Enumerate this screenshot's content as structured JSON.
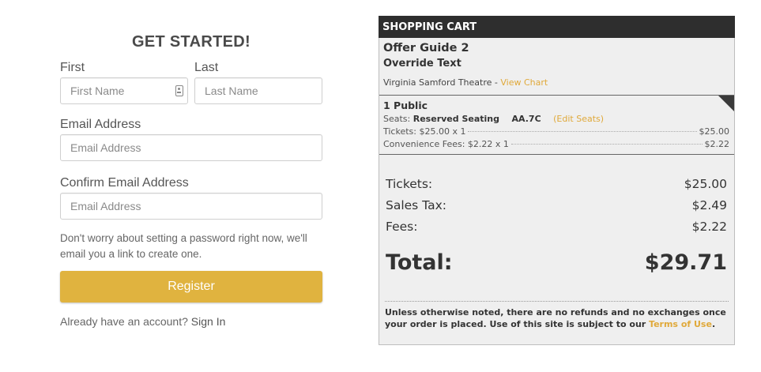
{
  "registration": {
    "title": "GET STARTED!",
    "first_label": "First",
    "first_placeholder": "First Name",
    "last_label": "Last",
    "last_placeholder": "Last Name",
    "email_label": "Email Address",
    "email_placeholder": "Email Address",
    "confirm_email_label": "Confirm Email Address",
    "confirm_email_placeholder": "Email Address",
    "note": "Don't worry about setting a password right now, we'll email you a link to create one.",
    "register_label": "Register",
    "account_prompt": "Already have an account?",
    "signin_label": "Sign In",
    "accent_color": "#e0b33f"
  },
  "cart": {
    "header": "SHOPPING CART",
    "offer_title": "Offer Guide 2",
    "override_text": "Override Text",
    "venue": "Virginia Samford Theatre",
    "venue_separator": " - ",
    "view_chart_label": "View Chart",
    "item": {
      "title": "1 Public",
      "seats_label": "Seats:",
      "seating_type": "Reserved Seating",
      "seat_id": "AA.7C",
      "edit_seats_label": "(Edit Seats)",
      "tickets_label": "Tickets: $25.00 x 1",
      "tickets_amount": "$25.00",
      "fees_label": "Convenience Fees: $2.22 x 1",
      "fees_amount": "$2.22"
    },
    "totals": {
      "tickets_label": "Tickets:",
      "tickets_value": "$25.00",
      "sales_tax_label": "Sales Tax:",
      "sales_tax_value": "$2.49",
      "fees_label": "Fees:",
      "fees_value": "$2.22",
      "total_label": "Total:",
      "total_value": "$29.71"
    },
    "disclaimer_text": "Unless otherwise noted, there are no refunds and no exchanges once your order is placed. Use of this site is subject to our ",
    "terms_label": "Terms of Use",
    "disclaimer_end": ".",
    "link_color": "#e0a93a",
    "header_color": "#2e2e2e"
  }
}
